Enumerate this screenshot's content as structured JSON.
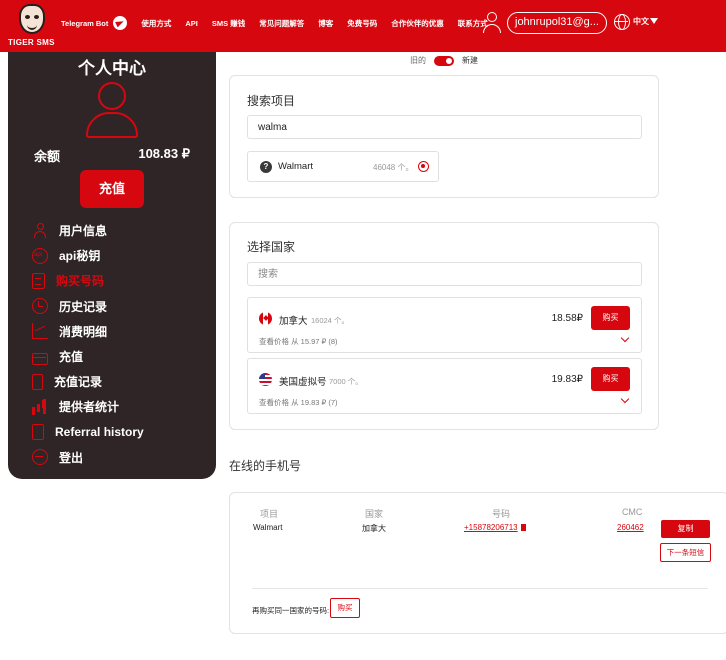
{
  "header": {
    "logo_text": "TIGER SMS",
    "nav": [
      "Telegram Bot",
      "使用方式",
      "API",
      "SMS 赚钱",
      "常见问题解答",
      "博客",
      "免费号码",
      "合作伙伴的优惠",
      "联系方式"
    ],
    "email": "johnrupol31@g...",
    "language": "中文",
    "icons": [
      "telegram-icon",
      "user-icon",
      "globe-icon",
      "caret-down-icon"
    ],
    "accent_color": "#d6070f"
  },
  "sidebar": {
    "title": "个人中心",
    "balance_label": "余额",
    "balance_value": "108.83 ₽",
    "recharge_label": "充值",
    "background_color": "#2f2526",
    "items": [
      {
        "label": "用户信息",
        "icon": "user-icon",
        "active": false
      },
      {
        "label": "api秘钥",
        "icon": "api-icon",
        "active": false
      },
      {
        "label": "购买号码",
        "icon": "document-icon",
        "active": true
      },
      {
        "label": "历史记录",
        "icon": "history-icon",
        "active": false
      },
      {
        "label": "消费明细",
        "icon": "chart-icon",
        "active": false
      },
      {
        "label": "充值",
        "icon": "card-icon",
        "active": false
      },
      {
        "label": "充值记录",
        "icon": "phone-icon",
        "active": false
      },
      {
        "label": "提供者统计",
        "icon": "bars-icon",
        "active": false
      },
      {
        "label": "Referral history",
        "icon": "referral-icon",
        "active": false
      },
      {
        "label": "登出",
        "icon": "logout-icon",
        "active": false
      }
    ]
  },
  "toggle": {
    "old_label": "旧的",
    "new_label": "新建",
    "on": true
  },
  "search_service": {
    "title": "搜索项目",
    "value": "walma",
    "result": {
      "name": "Walmart",
      "count": "46048 个。",
      "selected": true
    }
  },
  "select_country": {
    "title": "选择国家",
    "placeholder": "搜索",
    "countries": [
      {
        "flag": "flag-canada",
        "name": "加拿大",
        "count": "16024 个。",
        "price": "18.58₽",
        "buy_label": "购买",
        "sub": "查看价格 从 15.97 ₽ (8)"
      },
      {
        "flag": "flag-usa",
        "name": "美国虚拟号",
        "count": "7000 个。",
        "price": "19.83₽",
        "buy_label": "购买",
        "sub": "查看价格 从 19.83 ₽ (7)"
      }
    ]
  },
  "online_numbers": {
    "title": "在线的手机号",
    "headers": {
      "project": "项目",
      "country": "国家",
      "number": "号码",
      "cmc": "СМС"
    },
    "row": {
      "project": "Walmart",
      "country": "加拿大",
      "number": "+15878206713",
      "code": "260462"
    },
    "copy_label": "复制",
    "next_label": "下一条短信",
    "rebuy_label": "再购买同一国家的号码:",
    "rebuy_button": "购买"
  }
}
